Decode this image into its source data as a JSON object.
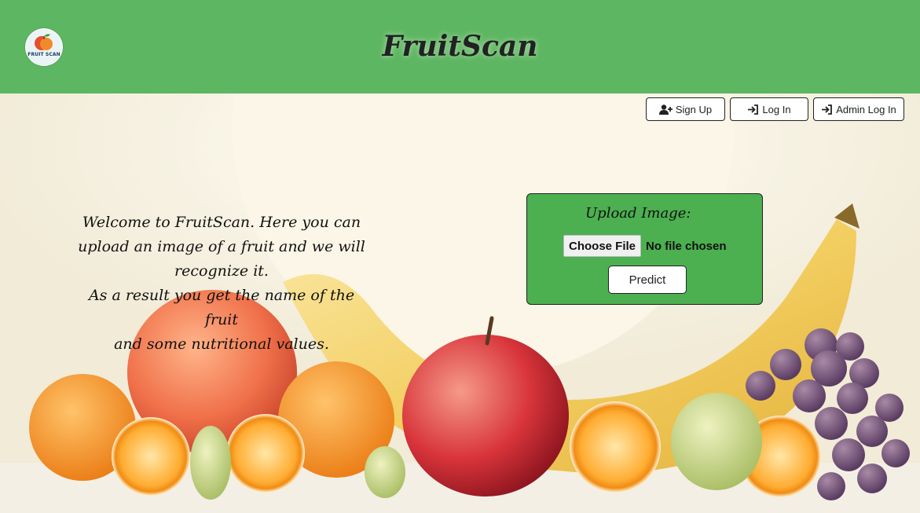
{
  "header": {
    "brand": "FruitScan",
    "logo_text": "FRUIT SCAN"
  },
  "auth": {
    "signup_label": "Sign Up",
    "login_label": "Log In",
    "admin_login_label": "Admin Log In"
  },
  "welcome": {
    "lines": [
      "Welcome to FruitScan. Here you can",
      "upload an image of a fruit and we will",
      "recognize it.",
      "As a result you get the name of the fruit",
      "and some nutritional values."
    ]
  },
  "upload": {
    "title": "Upload Image:",
    "choose_file_label": "Choose File",
    "file_status": "No file chosen",
    "predict_label": "Predict"
  },
  "colors": {
    "header_bg": "#5db661",
    "card_bg": "#4caf50"
  },
  "icons": {
    "signup": "user-plus-icon",
    "login": "sign-in-icon",
    "admin_login": "sign-in-icon"
  }
}
